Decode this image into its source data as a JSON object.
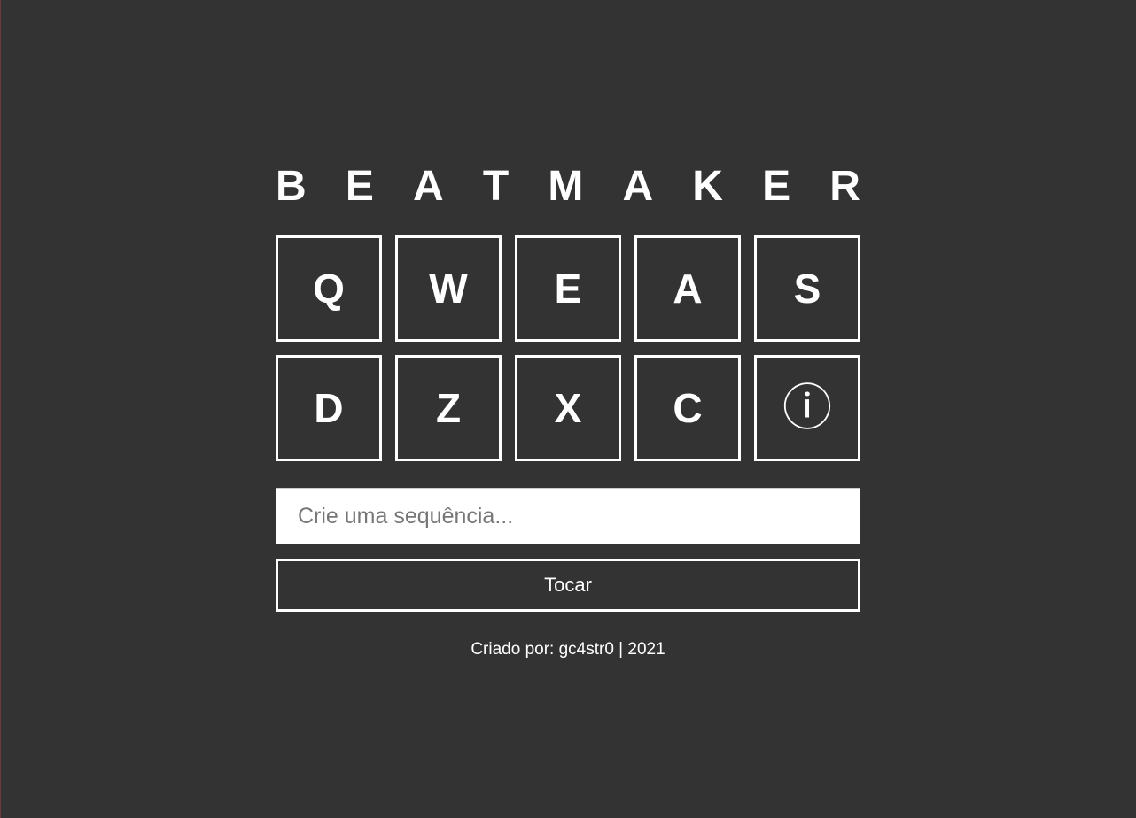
{
  "app": {
    "title_letters": [
      "B",
      "E",
      "A",
      "T",
      "M",
      "A",
      "K",
      "E",
      "R"
    ]
  },
  "pads": [
    {
      "key": "Q",
      "type": "key"
    },
    {
      "key": "W",
      "type": "key"
    },
    {
      "key": "E",
      "type": "key"
    },
    {
      "key": "A",
      "type": "key"
    },
    {
      "key": "S",
      "type": "key"
    },
    {
      "key": "D",
      "type": "key"
    },
    {
      "key": "Z",
      "type": "key"
    },
    {
      "key": "X",
      "type": "key"
    },
    {
      "key": "C",
      "type": "key"
    },
    {
      "key": "ⓘ",
      "type": "info",
      "icon": "info-icon"
    }
  ],
  "sequence": {
    "value": "",
    "placeholder": "Crie uma sequência..."
  },
  "play_button": {
    "label": "Tocar"
  },
  "footer": {
    "text": "Criado por: gc4str0 | 2021"
  },
  "colors": {
    "background": "#333333",
    "foreground": "#ffffff",
    "input_background": "#ffffff"
  }
}
